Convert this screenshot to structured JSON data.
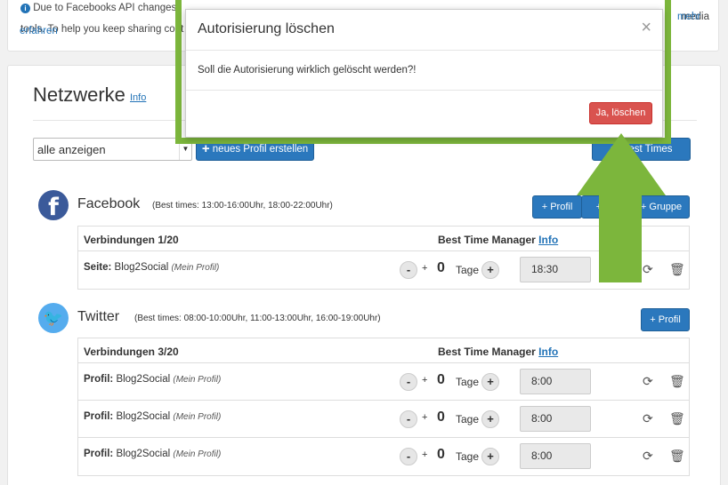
{
  "notice": {
    "line1": "Due to Facebooks API changes",
    "obscured": "...",
    "right_text": "media",
    "line2": "tools. To help you keep sharing cont",
    "more_link": "mehr",
    "more_link2": "erfahren"
  },
  "page": {
    "title": "Netzwerke",
    "title_info": "Info",
    "filter_value": "alle anzeigen",
    "new_profile_button": "neues Profil erstellen",
    "best_times_button": "Best Times"
  },
  "facebook": {
    "name": "Facebook",
    "best_times": "(Best times: 13:00-16:00Uhr, 18:00-22:00Uhr)",
    "btn_profil": "+ Profil",
    "btn_seite": "+",
    "btn_gruppe": "+ Gruppe",
    "connections_label": "Verbindungen 1/20",
    "btm_label": "Best Time Manager",
    "btm_info": "Info",
    "rows": [
      {
        "type": "Seite:",
        "name": "Blog2Social",
        "note": "(Mein Profil)",
        "minus": "-",
        "plus_sign": "+",
        "days": "0",
        "unit": "Tage",
        "plus": "+",
        "time": "18:30"
      }
    ]
  },
  "twitter": {
    "name": "Twitter",
    "best_times": "(Best times: 08:00-10:00Uhr, 11:00-13:00Uhr, 16:00-19:00Uhr)",
    "btn_profil": "+ Profil",
    "connections_label": "Verbindungen 3/20",
    "btm_label": "Best Time Manager",
    "btm_info": "Info",
    "rows": [
      {
        "type": "Profil:",
        "name": "Blog2Social",
        "note": "(Mein Profil)",
        "minus": "-",
        "plus_sign": "+",
        "days": "0",
        "unit": "Tage",
        "plus": "+",
        "time": "8:00"
      },
      {
        "type": "Profil:",
        "name": "Blog2Social",
        "note": "(Mein Profil)",
        "minus": "-",
        "plus_sign": "+",
        "days": "0",
        "unit": "Tage",
        "plus": "+",
        "time": "8:00"
      },
      {
        "type": "Profil:",
        "name": "Blog2Social",
        "note": "(Mein Profil)",
        "minus": "-",
        "plus_sign": "+",
        "days": "0",
        "unit": "Tage",
        "plus": "+",
        "time": "8:00"
      }
    ]
  },
  "modal": {
    "title": "Autorisierung löschen",
    "close": "×",
    "body": "Soll die Autorisierung wirklich gelöscht werden?!",
    "confirm": "Ja, löschen"
  },
  "colors": {
    "accent": "#2b78bd",
    "danger": "#d9534f",
    "highlight": "#7cb63c",
    "facebook": "#3b5a9a",
    "twitter": "#55acee"
  }
}
